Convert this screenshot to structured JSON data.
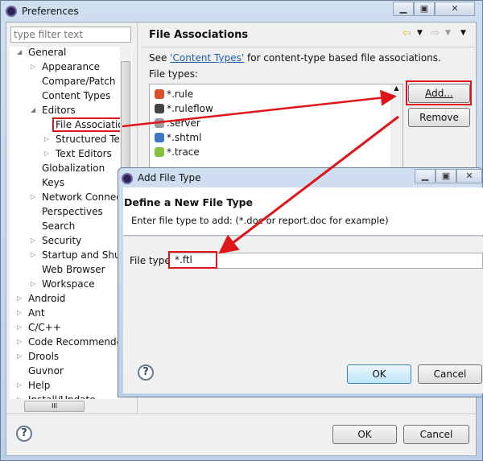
{
  "window": {
    "title": "Preferences"
  },
  "filter": {
    "placeholder": "type filter text"
  },
  "tree": [
    {
      "label": "General",
      "indent": 0,
      "arrow": "open"
    },
    {
      "label": "Appearance",
      "indent": 1,
      "arrow": "closed"
    },
    {
      "label": "Compare/Patch",
      "indent": 1,
      "arrow": ""
    },
    {
      "label": "Content Types",
      "indent": 1,
      "arrow": ""
    },
    {
      "label": "Editors",
      "indent": 1,
      "arrow": "open"
    },
    {
      "label": "File Associatio",
      "indent": 2,
      "arrow": "",
      "selected": true
    },
    {
      "label": "Structured Text",
      "indent": 2,
      "arrow": "closed"
    },
    {
      "label": "Text Editors",
      "indent": 2,
      "arrow": "closed"
    },
    {
      "label": "Globalization",
      "indent": 1,
      "arrow": ""
    },
    {
      "label": "Keys",
      "indent": 1,
      "arrow": ""
    },
    {
      "label": "Network Connect",
      "indent": 1,
      "arrow": "closed"
    },
    {
      "label": "Perspectives",
      "indent": 1,
      "arrow": ""
    },
    {
      "label": "Search",
      "indent": 1,
      "arrow": ""
    },
    {
      "label": "Security",
      "indent": 1,
      "arrow": "closed"
    },
    {
      "label": "Startup and Shutd",
      "indent": 1,
      "arrow": "closed"
    },
    {
      "label": "Web Browser",
      "indent": 1,
      "arrow": ""
    },
    {
      "label": "Workspace",
      "indent": 1,
      "arrow": "closed"
    },
    {
      "label": "Android",
      "indent": 0,
      "arrow": "closed"
    },
    {
      "label": "Ant",
      "indent": 0,
      "arrow": "closed"
    },
    {
      "label": "C/C++",
      "indent": 0,
      "arrow": "closed"
    },
    {
      "label": "Code Recommender",
      "indent": 0,
      "arrow": "closed"
    },
    {
      "label": "Drools",
      "indent": 0,
      "arrow": "closed"
    },
    {
      "label": "Guvnor",
      "indent": 0,
      "arrow": ""
    },
    {
      "label": "Help",
      "indent": 0,
      "arrow": "closed"
    },
    {
      "label": "Install/Update",
      "indent": 0,
      "arrow": "closed"
    }
  ],
  "page": {
    "title": "File Associations",
    "see": "See ",
    "link": "'Content Types'",
    "see_rest": " for content-type based file associations.",
    "file_types_label": "File types:",
    "file_types": [
      {
        "label": "*.rule",
        "icon": "rule-icon",
        "color": "#d9502b"
      },
      {
        "label": "*.ruleflow",
        "icon": "ruleflow-icon",
        "color": "#444444"
      },
      {
        "label": ".server",
        "icon": "server-icon",
        "color": "#9a9a9a"
      },
      {
        "label": "*.shtml",
        "icon": "globe-icon",
        "color": "#3a78c0"
      },
      {
        "label": "*.trace",
        "icon": "android-icon",
        "color": "#86c140"
      }
    ],
    "add": "Add...",
    "remove": "Remove"
  },
  "footer": {
    "ok": "OK",
    "cancel": "Cancel",
    "help": "?"
  },
  "dialog": {
    "title": "Add File Type",
    "heading": "Define a New File Type",
    "description": "Enter file type to add: (*.doc or report.doc for example)",
    "field_label": "File type:",
    "field_value": "*.ftl",
    "ok": "OK",
    "cancel": "Cancel",
    "help": "?"
  },
  "annotation_color": "#e0141b"
}
